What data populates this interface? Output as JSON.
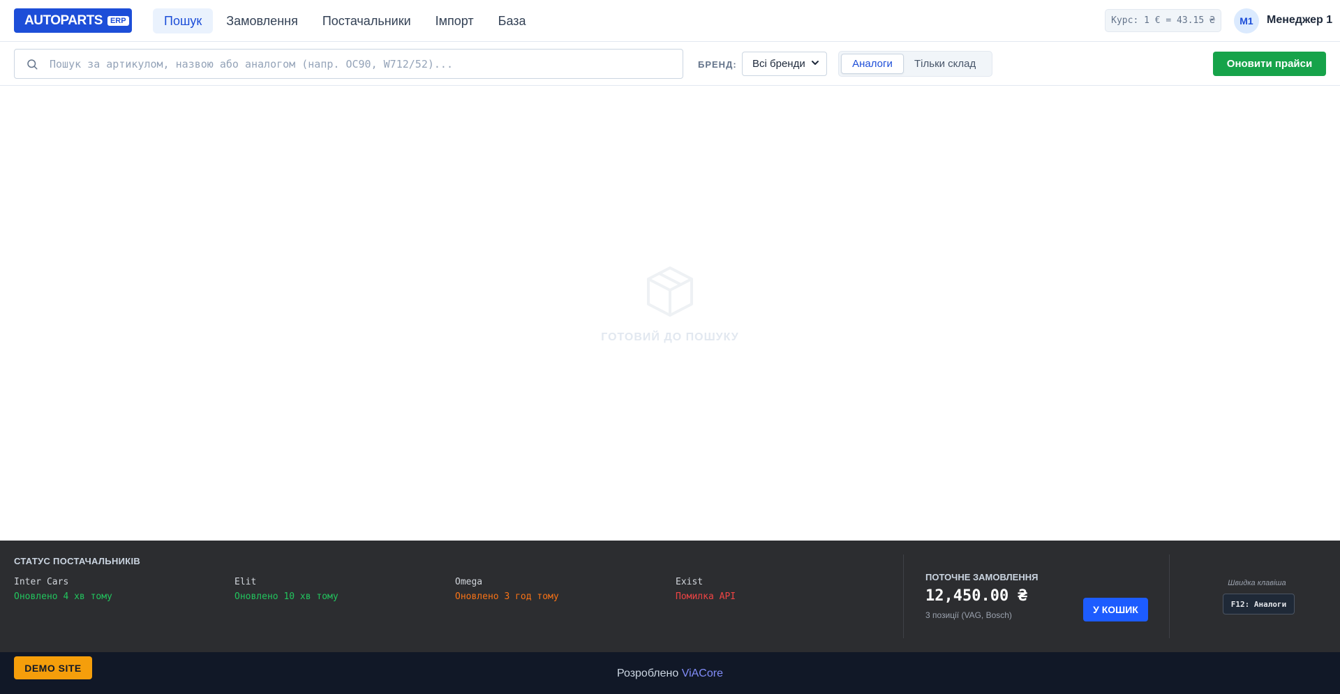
{
  "app": {
    "logo": "AUTOPARTS",
    "logo_badge": "ERP"
  },
  "nav": {
    "items": [
      {
        "label": "Пошук",
        "active": true
      },
      {
        "label": "Замовлення",
        "active": false
      },
      {
        "label": "Постачальники",
        "active": false
      },
      {
        "label": "Імпорт",
        "active": false
      },
      {
        "label": "База",
        "active": false
      }
    ]
  },
  "header": {
    "rate": "Курс: 1 € = 43.15 ₴",
    "avatar": "M1",
    "user_name": "Менеджер 1"
  },
  "toolbar": {
    "search_placeholder": "Пошук за артикулом, назвою або аналогом (напр. OC90, W712/52)...",
    "search_value": "",
    "brand_label": "БРЕНД:",
    "brand_selected": "Всі бренди",
    "mode_buttons": [
      {
        "label": "Аналоги",
        "active": true
      },
      {
        "label": "Тільки склад",
        "active": false
      }
    ],
    "refresh_label": "Оновити прайси"
  },
  "empty_state": {
    "icon": "box-icon",
    "text": "ГОТОВИЙ ДО ПОШУКУ"
  },
  "suppliers": {
    "title": "СТАТУС ПОСТАЧАЛЬНИКІВ",
    "items": [
      {
        "name": "Inter Cars",
        "status": "Оновлено 4 хв тому",
        "color": "#22c55e"
      },
      {
        "name": "Elit",
        "status": "Оновлено 10 хв тому",
        "color": "#22c55e"
      },
      {
        "name": "Omega",
        "status": "Оновлено 3 год тому",
        "color": "#f97316"
      },
      {
        "name": "Exist",
        "status": "Помилка API",
        "color": "#ef4444"
      }
    ]
  },
  "order": {
    "title": "ПОТОЧНЕ ЗАМОВЛЕННЯ",
    "amount": "12,450.00 ₴",
    "summary": "3 позиції (VAG, Bosch)",
    "cart_label": "У КОШИК"
  },
  "hotkey": {
    "label": "Швидка клавіша",
    "key": "F12: Аналоги"
  },
  "footer": {
    "demo_label": "DEMO SITE",
    "credits_prefix": "Розроблено",
    "credits_link": "ViACore"
  },
  "colors": {
    "brand": "#1d4ed8",
    "refresh": "#16a34a",
    "cart": "#1d5cff",
    "demo": "#f59e0b"
  }
}
